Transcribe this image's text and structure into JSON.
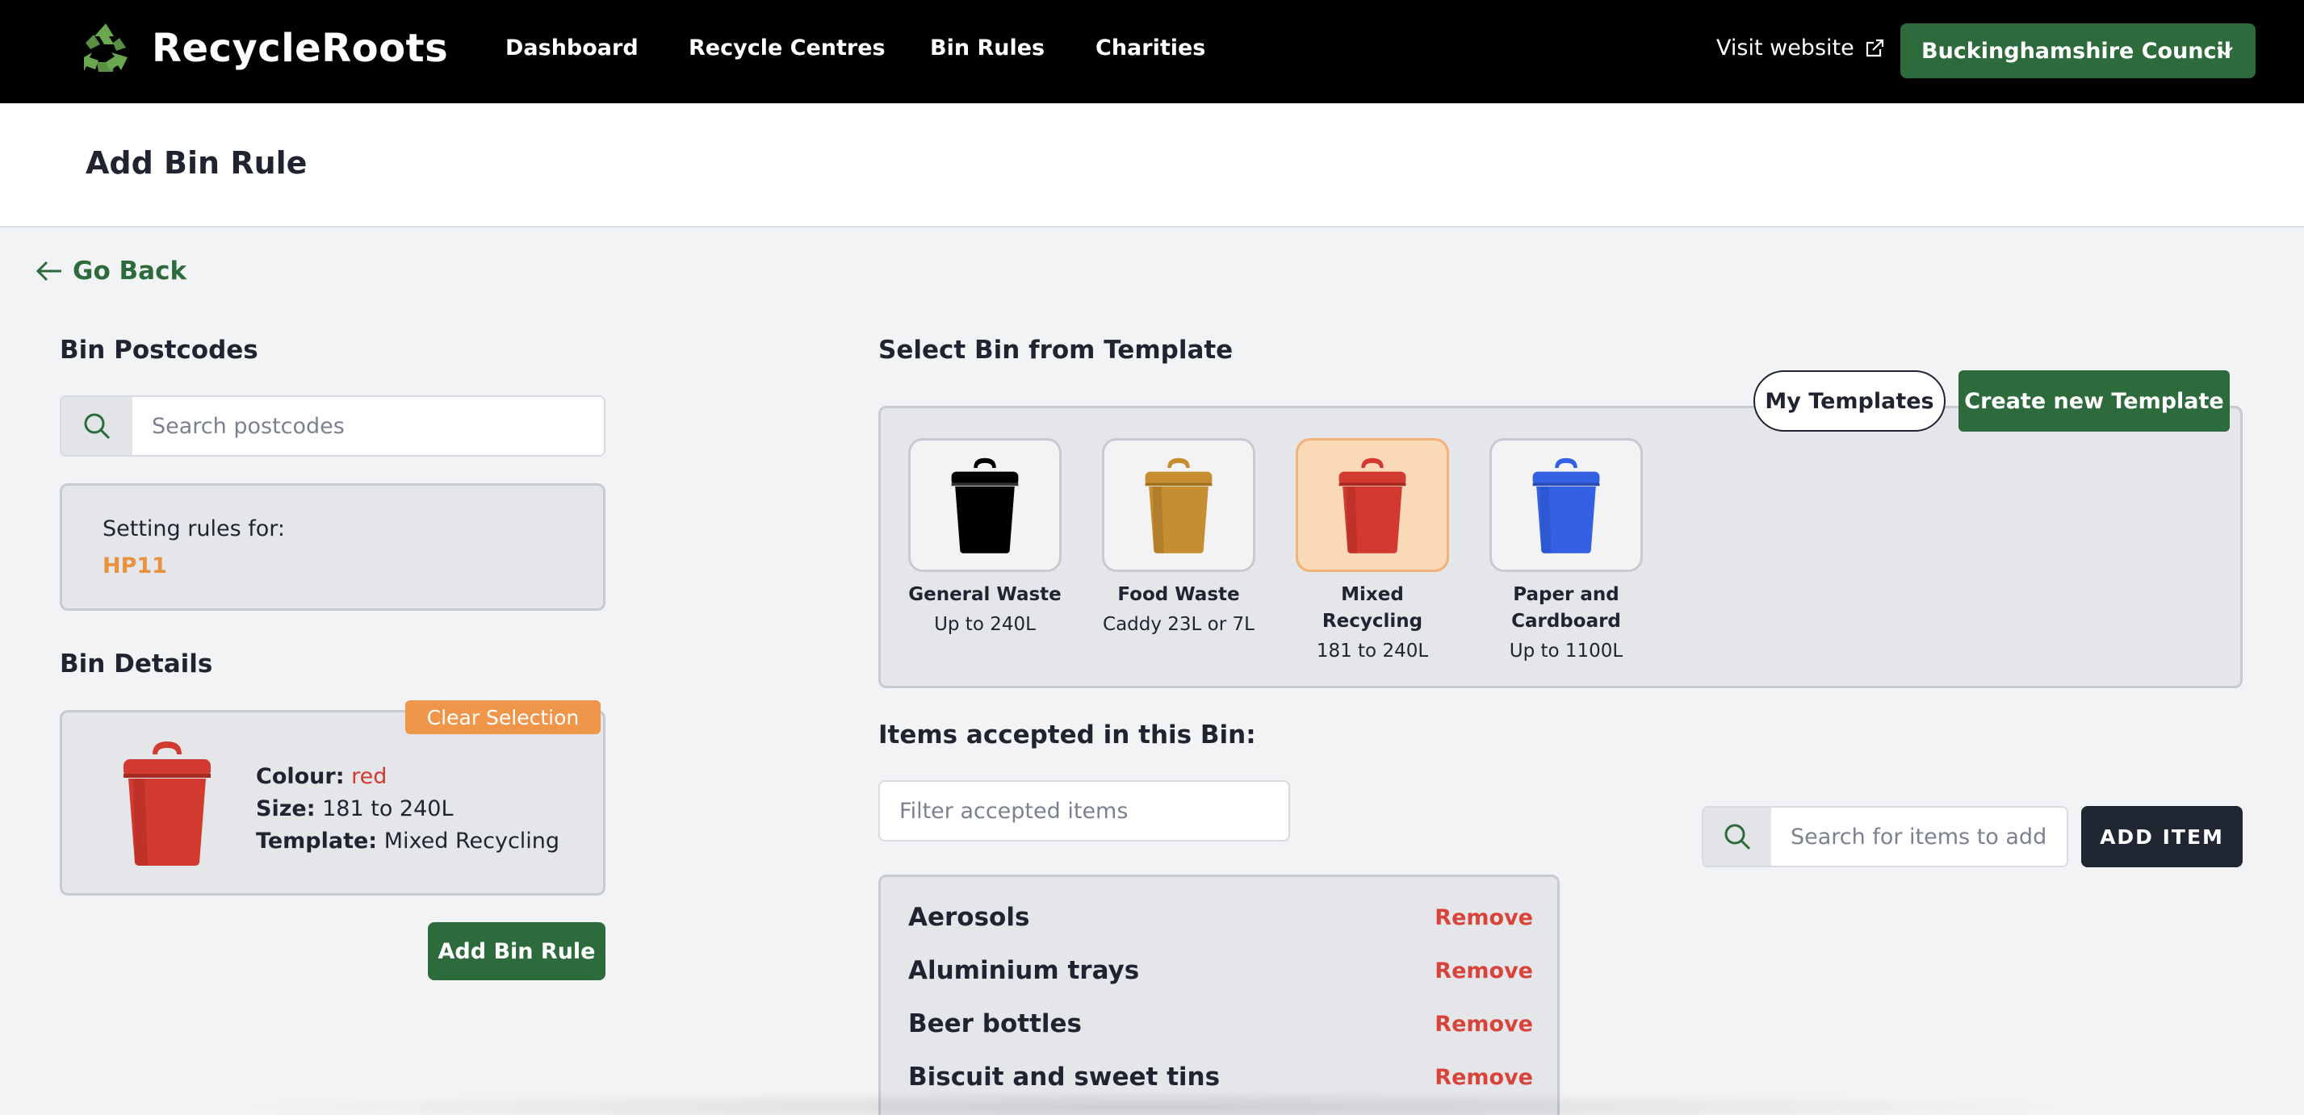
{
  "app": {
    "name": "RecycleRoots",
    "logo_icon": "recycle-icon",
    "brand_color": "#2e6b3c"
  },
  "nav": {
    "items": [
      "Dashboard",
      "Recycle Centres",
      "Bin Rules",
      "Charities"
    ],
    "visit_label": "Visit website",
    "council_label": "Buckinghamshire Council"
  },
  "page": {
    "title": "Add Bin Rule",
    "back_label": "Go Back"
  },
  "postcodes": {
    "title": "Bin Postcodes",
    "search_placeholder": "Search postcodes",
    "setting_label": "Setting rules for:",
    "selected_postcode": "HP11"
  },
  "details": {
    "title": "Bin Details",
    "clear_label": "Clear Selection",
    "colour_label": "Colour:",
    "colour_value": "red",
    "size_label": "Size:",
    "size_value": "181 to 240L",
    "template_label": "Template:",
    "template_value": "Mixed Recycling",
    "bin_color": "#d33a2f"
  },
  "add_rule_label": "Add Bin Rule",
  "templates": {
    "title": "Select Bin from Template",
    "my_templates_label": "My Templates",
    "create_label": "Create new Template",
    "items": [
      {
        "name": "General Waste",
        "size": "Up to 240L",
        "color": "#000000",
        "selected": false
      },
      {
        "name": "Food Waste",
        "size": "Caddy 23L or 7L",
        "color": "#c68e30",
        "selected": false
      },
      {
        "name": "Mixed Recycling",
        "size": "181 to 240L",
        "color": "#d33a2f",
        "selected": true
      },
      {
        "name": "Paper and Cardboard",
        "size": "Up to 1100L",
        "color": "#3461e3",
        "selected": false
      }
    ]
  },
  "accepted": {
    "title": "Items accepted in this Bin:",
    "filter_placeholder": "Filter accepted items",
    "add_search_placeholder": "Search for items to add",
    "add_label": "ADD ITEM",
    "remove_label": "Remove",
    "items": [
      "Aerosols",
      "Aluminium trays",
      "Beer bottles",
      "Biscuit and sweet tins"
    ]
  }
}
